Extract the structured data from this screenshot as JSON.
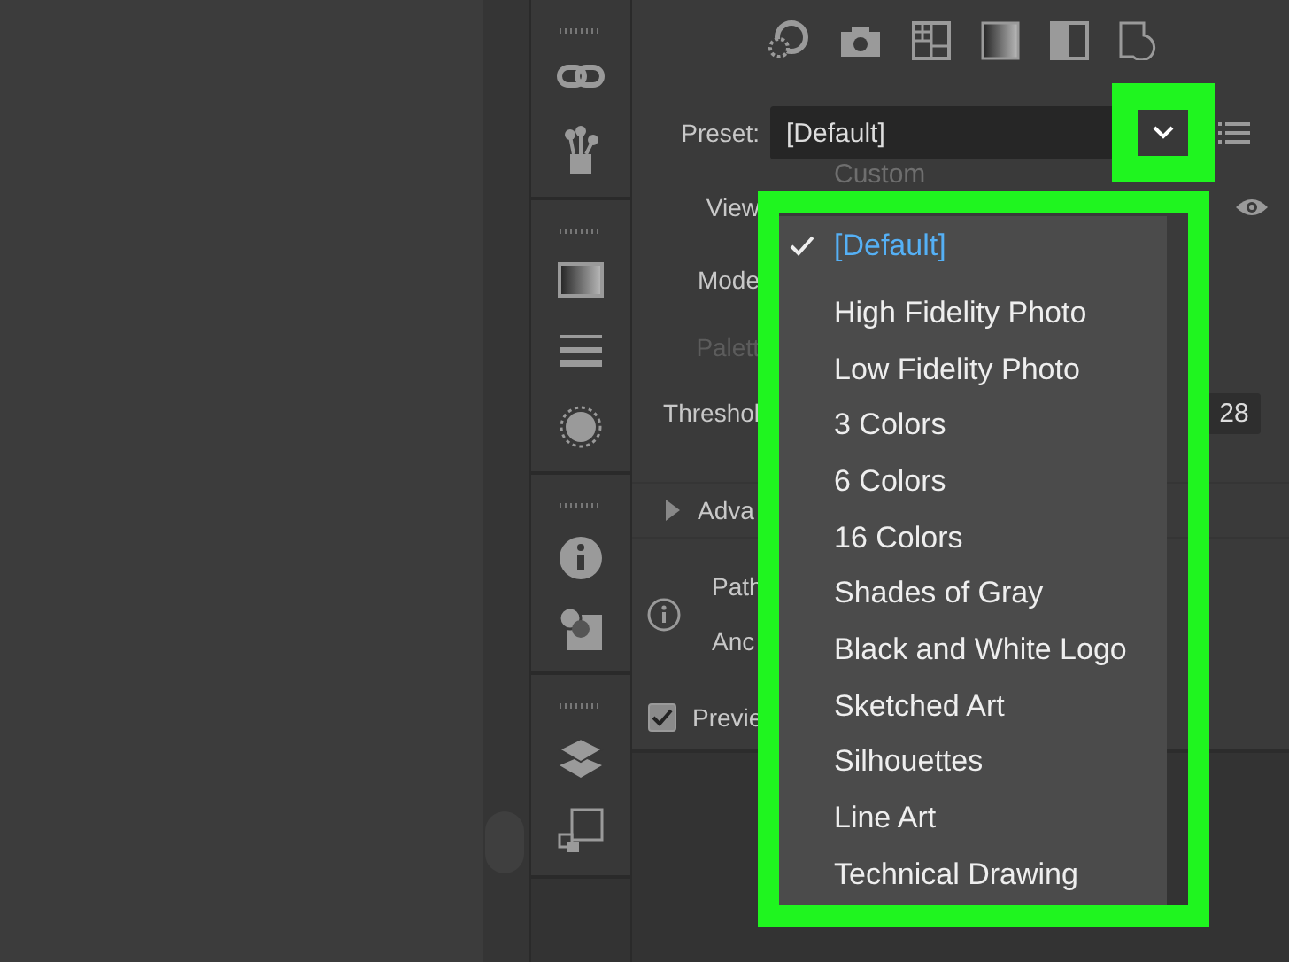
{
  "preset": {
    "label": "Preset:",
    "value": "[Default]"
  },
  "preset_menu": {
    "ghost_item": "Custom",
    "items": [
      {
        "label": "[Default]",
        "selected": true
      },
      {
        "label": "High Fidelity Photo",
        "selected": false
      },
      {
        "label": "Low Fidelity Photo",
        "selected": false
      },
      {
        "label": "3 Colors",
        "selected": false
      },
      {
        "label": "6 Colors",
        "selected": false
      },
      {
        "label": "16 Colors",
        "selected": false
      },
      {
        "label": "Shades of Gray",
        "selected": false
      },
      {
        "label": "Black and White Logo",
        "selected": false
      },
      {
        "label": "Sketched Art",
        "selected": false
      },
      {
        "label": "Silhouettes",
        "selected": false
      },
      {
        "label": "Line Art",
        "selected": false
      },
      {
        "label": "Technical Drawing",
        "selected": false
      }
    ]
  },
  "fields": [
    {
      "kind": "view",
      "label": "View",
      "disabled": false
    },
    {
      "kind": "plain",
      "label": "Mode",
      "disabled": false
    },
    {
      "kind": "plain",
      "label": "Palett",
      "disabled": true
    },
    {
      "kind": "number",
      "label": "Threshol",
      "disabled": false,
      "value": "28"
    }
  ],
  "advanced": {
    "label": "Adva",
    "expanded": false
  },
  "info": [
    "Path",
    "Anc"
  ],
  "preview": {
    "label": "Previe",
    "checked": true
  }
}
